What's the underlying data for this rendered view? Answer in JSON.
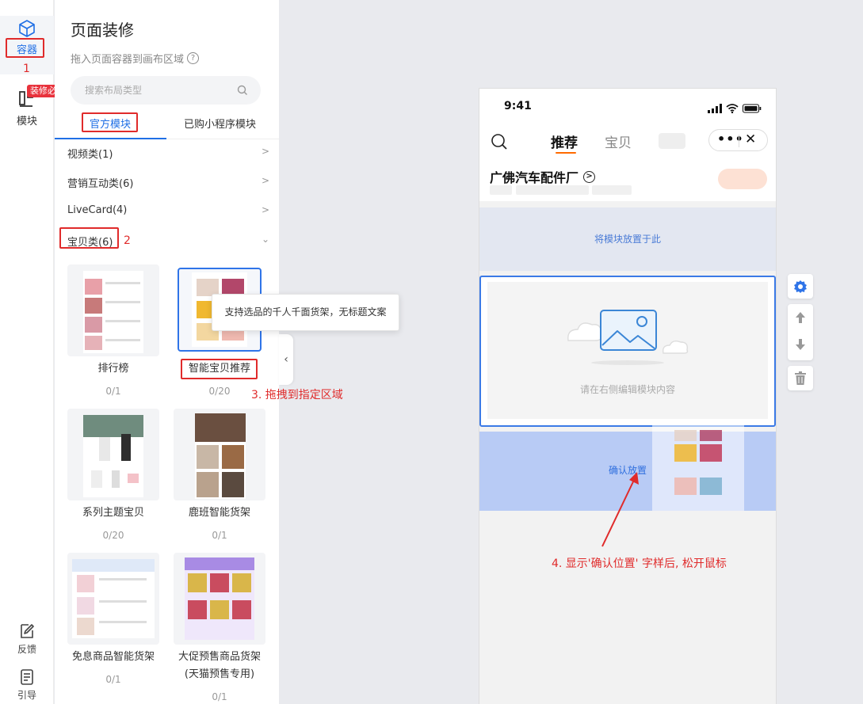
{
  "rail": {
    "container_label": "容器",
    "container_step": "1",
    "module_label": "模块",
    "module_badge": "装修必备",
    "feedback_label": "反馈",
    "guide_label": "引导"
  },
  "panel": {
    "title": "页面装修",
    "subtitle": "拖入页面容器到画布区域",
    "search_placeholder": "搜索布局类型",
    "tabs": [
      "官方模块",
      "已购小程序模块"
    ],
    "categories": [
      {
        "label": "视频类(1)",
        "expanded": false
      },
      {
        "label": "营销互动类(6)",
        "expanded": false
      },
      {
        "label": "LiveCard(4)",
        "expanded": false
      },
      {
        "label": "宝贝类(6)",
        "expanded": true,
        "step": "2"
      }
    ],
    "cards": [
      {
        "name": "排行榜",
        "count": "0/1"
      },
      {
        "name": "智能宝贝推荐",
        "count": "0/20"
      },
      {
        "name": "系列主题宝贝",
        "count": "0/20"
      },
      {
        "name": "鹿班智能货架",
        "count": "0/1"
      },
      {
        "name": "免息商品智能货架",
        "count": "0/1"
      },
      {
        "name": "大促预售商品货架",
        "name2": "(天猫预售专用)",
        "count": "0/1"
      }
    ],
    "tooltip": "支持选品的千人千面货架，无标题文案",
    "step3": "3. 拖拽到指定区域"
  },
  "phone": {
    "time": "9:41",
    "nav_tabs": [
      "推荐",
      "宝贝"
    ],
    "shop_name": "广佛汽车配件厂",
    "drop_hint": "将模块放置于此",
    "module_hint": "请在右侧编辑模块内容",
    "confirm_text": "确认放置"
  },
  "step4": "4. 显示'确认位置' 字样后, 松开鼠标",
  "colors": {
    "accent": "#1f6fe5",
    "annotation_red": "#e02b2b",
    "confirm_zone": "#b8cbf5",
    "drop_zone": "#e3e7f1",
    "orange_underline": "#ff6a00"
  }
}
